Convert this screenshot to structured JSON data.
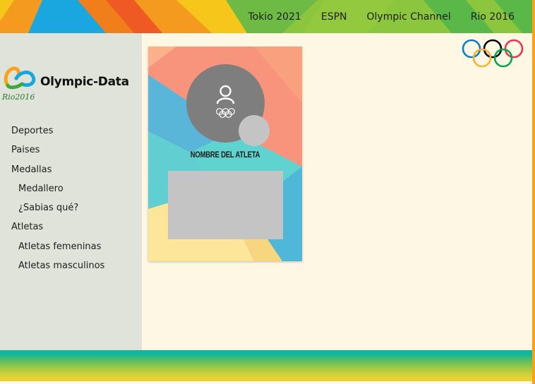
{
  "header": {
    "nav": [
      "Tokio 2021",
      "ESPN",
      "Olympic Channel",
      "Rio 2016"
    ]
  },
  "sidebar": {
    "brand_title": "Olympic-Data",
    "brand_sub": "Rio2016",
    "menu": [
      {
        "label": "Deportes"
      },
      {
        "label": "Paises"
      },
      {
        "label": "Medallas"
      },
      {
        "label": "Medallero"
      },
      {
        "label": "¿Sabias qué?"
      },
      {
        "label": "Atletas"
      },
      {
        "label": "Atletas femeninas"
      },
      {
        "label": "Atletas masculinos"
      }
    ]
  },
  "card": {
    "athlete_name": "NOMBRE DEL ATLETA",
    "avatar_icon": "user-icon",
    "avatar_rings": "olympic-rings-icon"
  },
  "colors": {
    "page_background": "#fdf7e4",
    "sidebar_background": "#dfe3da",
    "footer_teal": "#12b69c",
    "footer_yellow": "#f2d236",
    "frame_orange": "#f6a31b",
    "ring_blue": "#0081c8",
    "ring_yellow": "#fcb131",
    "ring_black": "#000000",
    "ring_green": "#00a651",
    "ring_red": "#ee334e"
  }
}
